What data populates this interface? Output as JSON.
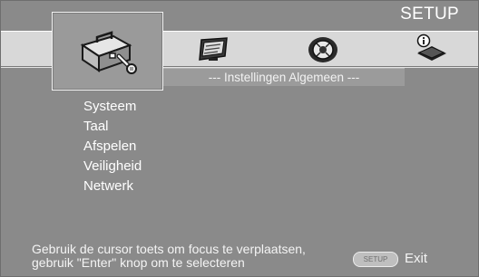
{
  "header": {
    "title": "SETUP"
  },
  "tabs": [
    {
      "icon": "toolbox-wrench-icon",
      "selected": true
    },
    {
      "icon": "display-icon",
      "selected": false
    },
    {
      "icon": "audio-dial-icon",
      "selected": false
    },
    {
      "icon": "info-book-icon",
      "selected": false
    }
  ],
  "section": {
    "title": "--- Instellingen Algemeen ---"
  },
  "menu": {
    "items": [
      {
        "label": "Systeem"
      },
      {
        "label": "Taal"
      },
      {
        "label": "Afspelen"
      },
      {
        "label": "Veiligheid"
      },
      {
        "label": "Netwerk"
      }
    ]
  },
  "footer": {
    "hint_line1": "Gebruik de cursor toets om focus te verplaatsen,",
    "hint_line2": "gebruik \"Enter\" knop om te selecteren",
    "setup_badge": "SETUP",
    "exit_label": "Exit"
  }
}
